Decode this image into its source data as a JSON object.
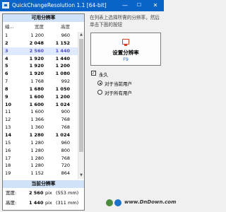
{
  "window": {
    "title": "QuickChangeResolution 1.1 [64-bit]",
    "controls": {
      "minimize": "—",
      "maximize": "☐",
      "close": "✕"
    }
  },
  "left_panel": {
    "available_title": "可用分辨率",
    "columns": {
      "no": "编...",
      "width": "宽度",
      "height": "高度"
    },
    "rows": [
      {
        "no": "1",
        "width": "1 200",
        "height": "960",
        "bold": false,
        "selected": false
      },
      {
        "no": "2",
        "width": "2 048",
        "height": "1 152",
        "bold": true,
        "selected": false
      },
      {
        "no": "3",
        "width": "2 560",
        "height": "1 440",
        "bold": true,
        "selected": true
      },
      {
        "no": "4",
        "width": "1 920",
        "height": "1 440",
        "bold": true,
        "selected": false
      },
      {
        "no": "5",
        "width": "1 920",
        "height": "1 200",
        "bold": true,
        "selected": false
      },
      {
        "no": "6",
        "width": "1 920",
        "height": "1 080",
        "bold": true,
        "selected": false
      },
      {
        "no": "7",
        "width": "1 768",
        "height": "992",
        "bold": false,
        "selected": false
      },
      {
        "no": "8",
        "width": "1 680",
        "height": "1 050",
        "bold": true,
        "selected": false
      },
      {
        "no": "9",
        "width": "1 600",
        "height": "1 200",
        "bold": true,
        "selected": false
      },
      {
        "no": "10",
        "width": "1 600",
        "height": "1 024",
        "bold": true,
        "selected": false
      },
      {
        "no": "11",
        "width": "1 600",
        "height": "900",
        "bold": false,
        "selected": false
      },
      {
        "no": "12",
        "width": "1 366",
        "height": "768",
        "bold": false,
        "selected": false
      },
      {
        "no": "13",
        "width": "1 360",
        "height": "768",
        "bold": false,
        "selected": false
      },
      {
        "no": "14",
        "width": "1 280",
        "height": "1 024",
        "bold": true,
        "selected": false
      },
      {
        "no": "15",
        "width": "1 280",
        "height": "960",
        "bold": false,
        "selected": false
      },
      {
        "no": "16",
        "width": "1 280",
        "height": "800",
        "bold": false,
        "selected": false
      },
      {
        "no": "17",
        "width": "1 280",
        "height": "768",
        "bold": false,
        "selected": false
      },
      {
        "no": "18",
        "width": "1 280",
        "height": "720",
        "bold": false,
        "selected": false
      },
      {
        "no": "19",
        "width": "1 152",
        "height": "864",
        "bold": false,
        "selected": false
      }
    ],
    "current_title": "当前分辨率",
    "current": {
      "width_label": "宽度:",
      "width_value": "2 560",
      "width_unit": "pix",
      "width_mm": "(553 mm)",
      "height_label": "高度:",
      "height_value": "1 440",
      "height_unit": "pix",
      "height_mm": "(311 mm)"
    }
  },
  "right_panel": {
    "instruction": "在列表上选择所需的分辨率，然后单击下面的按钮",
    "set_button": {
      "label": "设置分辨率",
      "shortcut": "F9",
      "icon": "monitor-icon"
    },
    "permanent": {
      "label": "永久",
      "checked": true,
      "mark": "✓"
    },
    "scope": {
      "current_user": {
        "label": "对于当前用户",
        "selected": true
      },
      "all_users": {
        "label": "对于所有用户",
        "selected": false
      }
    }
  },
  "footer": {
    "watermark": "www.DnDown.com"
  },
  "colors": {
    "titlebar": "#0a64c8",
    "header_bg": "#cfe2f8",
    "selection_text": "#5050c8",
    "shortcut": "#2c6cc8"
  }
}
